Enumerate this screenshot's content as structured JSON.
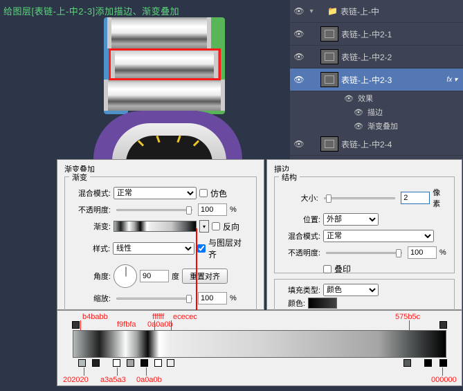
{
  "header": {
    "text": "给图层[表链-上-中2-3]添加描边、渐变叠加"
  },
  "layers": {
    "group": "表链-上-中",
    "items": [
      {
        "name": "表链-上-中2-1"
      },
      {
        "name": "表链-上-中2-2"
      },
      {
        "name": "表链-上-中2-3",
        "active": true
      },
      {
        "name": "表链-上-中2-4"
      }
    ],
    "effects_label": "效果",
    "effect_stroke": "描边",
    "effect_grad": "渐变叠加"
  },
  "grad_panel": {
    "title": "渐变叠加",
    "section": "渐变",
    "blend_label": "混合模式:",
    "blend_value": "正常",
    "dither_label": "仿色",
    "opacity_label": "不透明度:",
    "opacity_value": "100",
    "percent": "%",
    "gradient_label": "渐变:",
    "reverse_label": "反向",
    "style_label": "样式:",
    "style_value": "线性",
    "align_label": "与图层对齐",
    "angle_label": "角度:",
    "angle_value": "90",
    "degree": "度",
    "reset_btn": "重置对齐",
    "scale_label": "缩放:",
    "scale_value": "100"
  },
  "stroke_panel": {
    "title": "描边",
    "section": "结构",
    "size_label": "大小:",
    "size_value": "2",
    "px": "像素",
    "position_label": "位置:",
    "position_value": "外部",
    "blend_label": "混合模式:",
    "blend_value": "正常",
    "opacity_label": "不透明度:",
    "opacity_value": "100",
    "percent": "%",
    "overprint_label": "叠印",
    "fill_section": "",
    "fill_type_label": "填充类型:",
    "fill_type_value": "颜色",
    "color_label": "颜色:"
  },
  "gradient_stops": {
    "top": [
      {
        "label": "b4babb",
        "pos": 4
      },
      {
        "label": "f9fbfa",
        "pos": 14
      },
      {
        "label": "0a0a0b",
        "pos": 20
      },
      {
        "label": "ffffff",
        "pos": 23
      },
      {
        "label": "ececec",
        "pos": 26
      },
      {
        "label": "575b5c",
        "pos": 90
      }
    ],
    "bottom": [
      {
        "label": "202020",
        "pos": 7
      },
      {
        "label": "a3a5a3",
        "pos": 17
      },
      {
        "label": "0a0a0b",
        "pos": 22
      },
      {
        "label": "000000",
        "pos": 99
      }
    ]
  }
}
